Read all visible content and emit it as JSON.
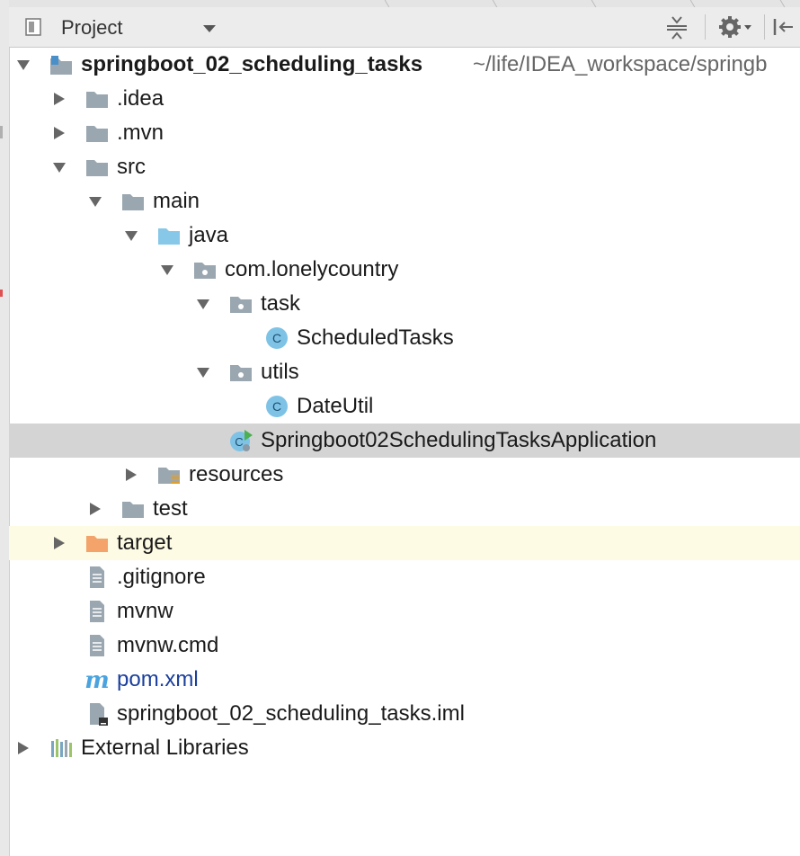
{
  "panel": {
    "title": "Project",
    "toolbar_icons": [
      "collapse-all-icon",
      "gear-icon",
      "hide-panel-icon"
    ]
  },
  "tree": [
    {
      "id": "root",
      "label": "springboot_02_scheduling_tasks",
      "path": "~/life/IDEA_workspace/springb",
      "icon": "module-folder-icon",
      "expanded": true,
      "bold": true
    },
    {
      "id": "idea",
      "label": ".idea",
      "icon": "folder-icon",
      "expanded": false
    },
    {
      "id": "mvn",
      "label": ".mvn",
      "icon": "folder-icon",
      "expanded": false
    },
    {
      "id": "src",
      "label": "src",
      "icon": "folder-icon",
      "expanded": true
    },
    {
      "id": "main",
      "label": "main",
      "icon": "folder-icon",
      "expanded": true
    },
    {
      "id": "java",
      "label": "java",
      "icon": "source-root-folder-icon",
      "expanded": true
    },
    {
      "id": "pkg",
      "label": "com.lonelycountry",
      "icon": "package-icon",
      "expanded": true
    },
    {
      "id": "task",
      "label": "task",
      "icon": "package-icon",
      "expanded": true
    },
    {
      "id": "scheduled",
      "label": "ScheduledTasks",
      "icon": "class-icon"
    },
    {
      "id": "utils",
      "label": "utils",
      "icon": "package-icon",
      "expanded": true
    },
    {
      "id": "dateutil",
      "label": "DateUtil",
      "icon": "class-icon"
    },
    {
      "id": "app",
      "label": "Springboot02SchedulingTasksApplication",
      "icon": "spring-boot-class-icon",
      "selected": true
    },
    {
      "id": "resources",
      "label": "resources",
      "icon": "resources-folder-icon",
      "expanded": false
    },
    {
      "id": "test",
      "label": "test",
      "icon": "folder-icon",
      "expanded": false
    },
    {
      "id": "target",
      "label": "target",
      "icon": "excluded-folder-icon",
      "expanded": false
    },
    {
      "id": "gitignore",
      "label": ".gitignore",
      "icon": "text-file-icon"
    },
    {
      "id": "mvnw",
      "label": "mvnw",
      "icon": "text-file-icon"
    },
    {
      "id": "mvnwcmd",
      "label": "mvnw.cmd",
      "icon": "text-file-icon"
    },
    {
      "id": "pom",
      "label": "pom.xml",
      "icon": "maven-icon"
    },
    {
      "id": "iml",
      "label": "springboot_02_scheduling_tasks.iml",
      "icon": "iml-file-icon"
    },
    {
      "id": "extlib",
      "label": "External Libraries",
      "icon": "libraries-icon",
      "expanded": false
    }
  ],
  "colors": {
    "folder": "#9aa7b0",
    "source_root": "#87c8e8",
    "excluded": "#f4a36b",
    "class_icon": "#7ec3e6",
    "selection": "#d4d4d4",
    "highlight_row": "#fdfbe3",
    "maven_link": "#1a3f9c"
  }
}
